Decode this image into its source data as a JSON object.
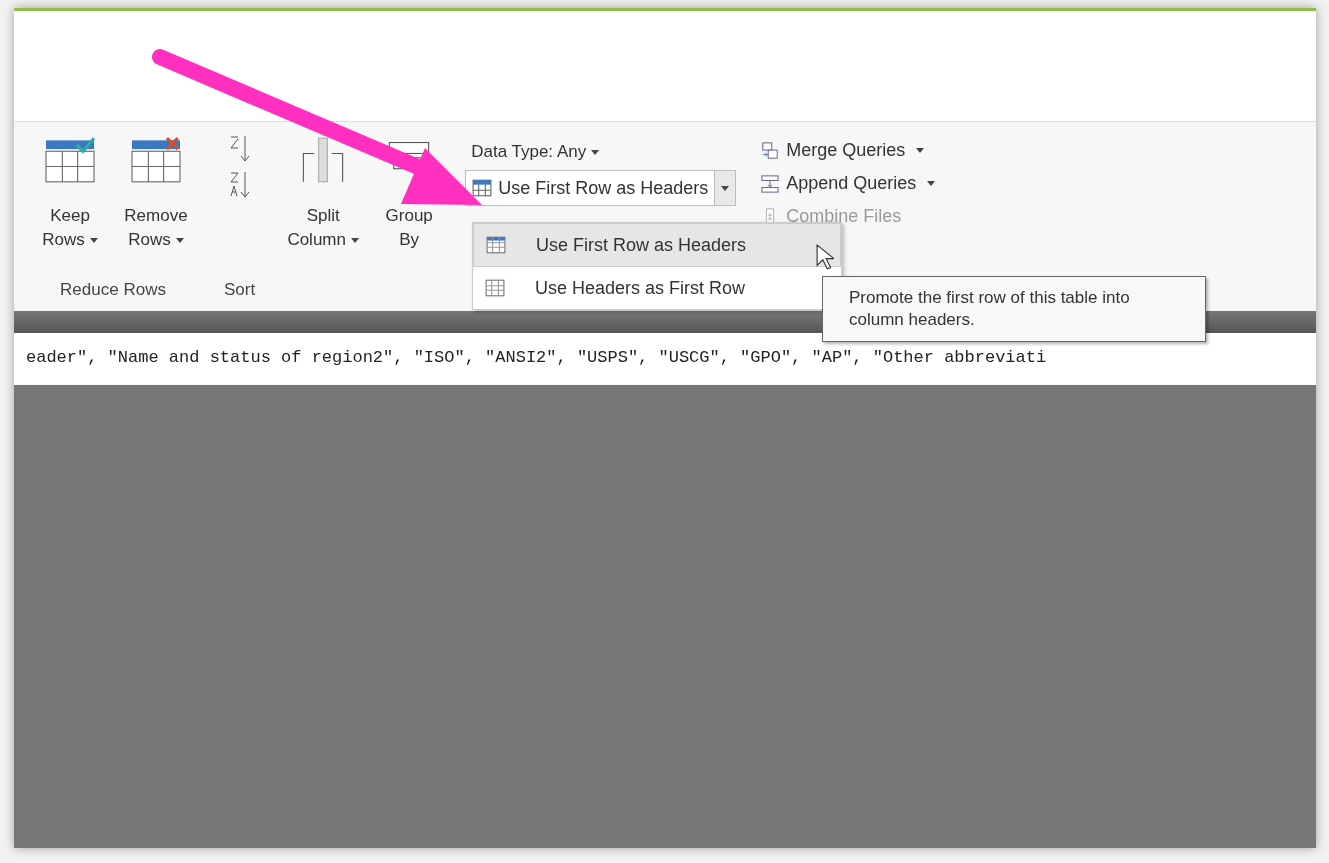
{
  "ribbon": {
    "groups": [
      {
        "kind": "large",
        "label": "Reduce Rows",
        "buttons": [
          {
            "lines": [
              "Keep",
              "Rows"
            ],
            "has_menu": true
          },
          {
            "lines": [
              "Remove",
              "Rows"
            ],
            "has_menu": true
          }
        ]
      },
      {
        "kind": "sort",
        "label": "Sort"
      },
      {
        "kind": "large",
        "buttons": [
          {
            "lines": [
              "Split",
              "Column"
            ],
            "has_menu": true
          },
          {
            "lines": [
              "Group",
              "By"
            ],
            "has_menu": false
          }
        ]
      }
    ],
    "transform": {
      "data_type": "Data Type: Any",
      "split_button": "Use First Row as Headers"
    },
    "combine": [
      {
        "label": "Merge Queries",
        "has_menu": true,
        "disabled": false
      },
      {
        "label": "Append Queries",
        "has_menu": true,
        "disabled": false
      },
      {
        "label": "Combine Files",
        "has_menu": false,
        "disabled": true
      }
    ]
  },
  "menu": [
    {
      "label": "Use First Row as Headers",
      "selected": true
    },
    {
      "label": "Use Headers as First Row",
      "selected": false
    }
  ],
  "tooltip": "Promote the first row of this table into column headers.",
  "formula": "eader\", \"Name and status of region2\", \"ISO\", \"ANSI2\", \"USPS\", \"USCG\", \"GPO\", \"AP\", \"Other abbreviati"
}
